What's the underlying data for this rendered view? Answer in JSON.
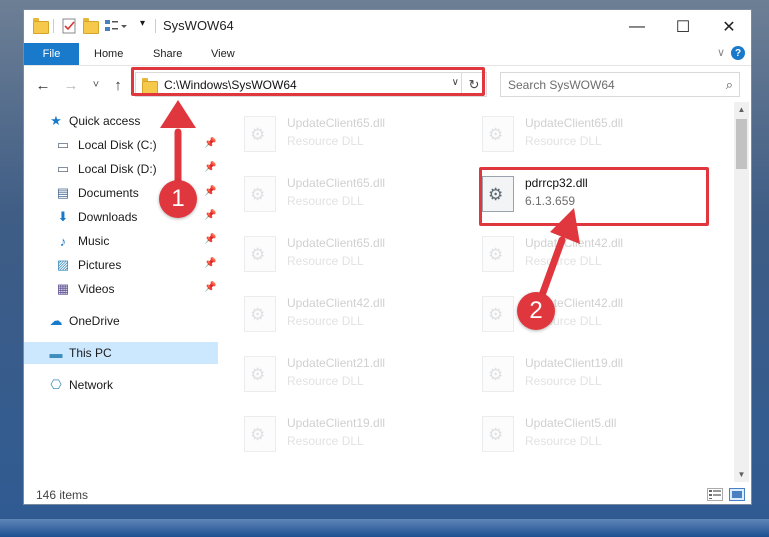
{
  "window": {
    "title": "SysWOW64",
    "minimize_glyph": "—",
    "maximize_glyph": "☐",
    "close_glyph": "✕"
  },
  "ribbon": {
    "file_label": "File",
    "tabs": [
      "Home",
      "Share",
      "View"
    ],
    "help_glyph": "?",
    "expand_glyph": "∨"
  },
  "nav": {
    "back_glyph": "←",
    "forward_glyph": "→",
    "recent_glyph": "˅",
    "up_glyph": "↑",
    "address": "C:\\Windows\\SysWOW64",
    "address_drop_glyph": "∨",
    "refresh_glyph": "↻",
    "search_placeholder": "Search SysWOW64",
    "search_glyph": "⌕"
  },
  "sidebar": {
    "pin_glyph": "📌",
    "items": [
      {
        "label": "Quick access",
        "icon": "star-icon",
        "glyph": "★",
        "color": "#1979ca"
      },
      {
        "label": "Local Disk (C:)",
        "icon": "drive-icon",
        "glyph": "▭",
        "color": "#5a6b7d",
        "pinned": true
      },
      {
        "label": "Local Disk (D:)",
        "icon": "drive-icon",
        "glyph": "▭",
        "color": "#5a6b7d",
        "pinned": true
      },
      {
        "label": "Documents",
        "icon": "documents-icon",
        "glyph": "▤",
        "color": "#4a6b8f",
        "pinned": true
      },
      {
        "label": "Downloads",
        "icon": "downloads-icon",
        "glyph": "⬇",
        "color": "#1979ca",
        "pinned": true
      },
      {
        "label": "Music",
        "icon": "music-icon",
        "glyph": "♪",
        "color": "#1979ca",
        "pinned": true
      },
      {
        "label": "Pictures",
        "icon": "pictures-icon",
        "glyph": "▨",
        "color": "#3c8dbc",
        "pinned": true
      },
      {
        "label": "Videos",
        "icon": "videos-icon",
        "glyph": "▦",
        "color": "#5a4a8f",
        "pinned": true
      },
      {
        "label": "OneDrive",
        "icon": "cloud-icon",
        "glyph": "☁",
        "color": "#1979ca"
      },
      {
        "label": "This PC",
        "icon": "computer-icon",
        "glyph": "▬",
        "color": "#3c8dbc",
        "selected": true
      },
      {
        "label": "Network",
        "icon": "network-icon",
        "glyph": "⎔",
        "color": "#3c8dbc"
      }
    ]
  },
  "files": [
    {
      "name": "UpdateClient65.dll",
      "desc": "Resource DLL"
    },
    {
      "name": "UpdateClient65.dll",
      "desc": "Resource DLL"
    },
    {
      "name": "UpdateClient65.dll",
      "desc": "Resource DLL"
    },
    {
      "name": "pdrrcp32.dll",
      "desc": "6.1.3.659",
      "active": true
    },
    {
      "name": "UpdateClient65.dll",
      "desc": "Resource DLL"
    },
    {
      "name": "UpdateClient42.dll",
      "desc": "Resource DLL"
    },
    {
      "name": "UpdateClient42.dll",
      "desc": "Resource DLL"
    },
    {
      "name": "UpdateClient42.dll",
      "desc": "Resource DLL"
    },
    {
      "name": "UpdateClient21.dll",
      "desc": "Resource DLL"
    },
    {
      "name": "UpdateClient19.dll",
      "desc": "Resource DLL"
    },
    {
      "name": "UpdateClient19.dll",
      "desc": "Resource DLL"
    },
    {
      "name": "UpdateClient5.dll",
      "desc": "Resource DLL"
    }
  ],
  "scroll": {
    "up_glyph": "▲",
    "down_glyph": "▼"
  },
  "status": {
    "item_count": "146 items"
  },
  "annotations": {
    "step1": "1",
    "step2": "2",
    "color": "#e0373e"
  }
}
